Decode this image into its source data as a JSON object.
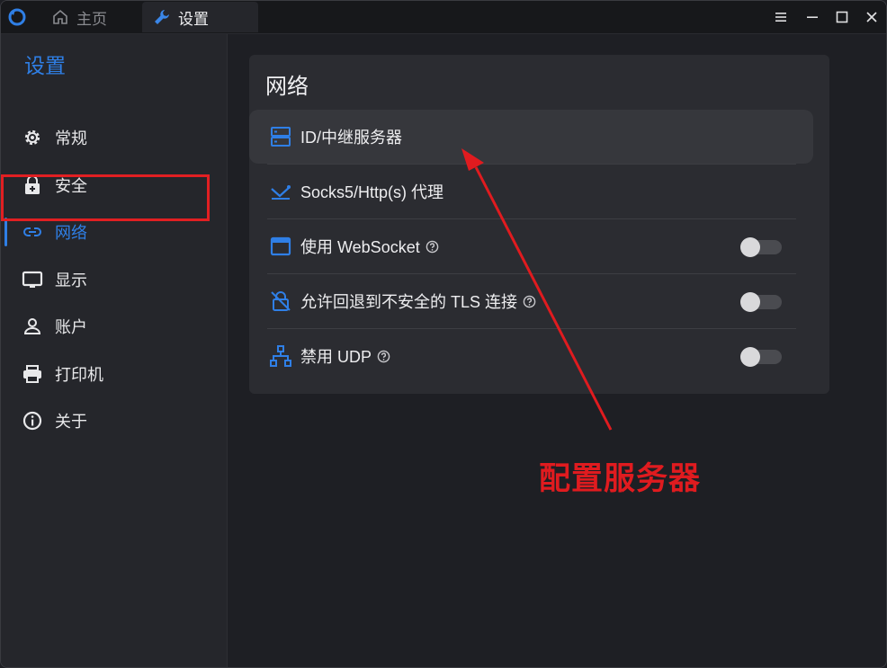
{
  "tabs": {
    "home": {
      "label": "主页",
      "icon": "home-icon"
    },
    "settings": {
      "label": "设置",
      "icon": "wrench-icon"
    }
  },
  "sidebar": {
    "title": "设置",
    "items": [
      {
        "label": "常规",
        "icon": "gear-icon"
      },
      {
        "label": "安全",
        "icon": "lock-icon"
      },
      {
        "label": "网络",
        "icon": "link-icon",
        "active": true
      },
      {
        "label": "显示",
        "icon": "monitor-icon"
      },
      {
        "label": "账户",
        "icon": "user-icon"
      },
      {
        "label": "打印机",
        "icon": "printer-icon"
      },
      {
        "label": "关于",
        "icon": "info-icon"
      }
    ]
  },
  "network": {
    "title": "网络",
    "rows": [
      {
        "label": "ID/中继服务器",
        "icon": "server-icon"
      },
      {
        "label": "Socks5/Http(s) 代理",
        "icon": "proxy-icon"
      },
      {
        "label": "使用 WebSocket",
        "icon": "window-icon",
        "help": true,
        "toggle": false
      },
      {
        "label": "允许回退到不安全的 TLS 连接",
        "icon": "unlock-icon",
        "help": true,
        "toggle": false
      },
      {
        "label": "禁用 UDP",
        "icon": "network-tree-icon",
        "help": true,
        "toggle": false
      }
    ]
  },
  "annotation": {
    "text": "配置服务器"
  },
  "colors": {
    "accent": "#2f7fe6",
    "annotation": "#e01b1f",
    "background": "#1e1f24"
  }
}
